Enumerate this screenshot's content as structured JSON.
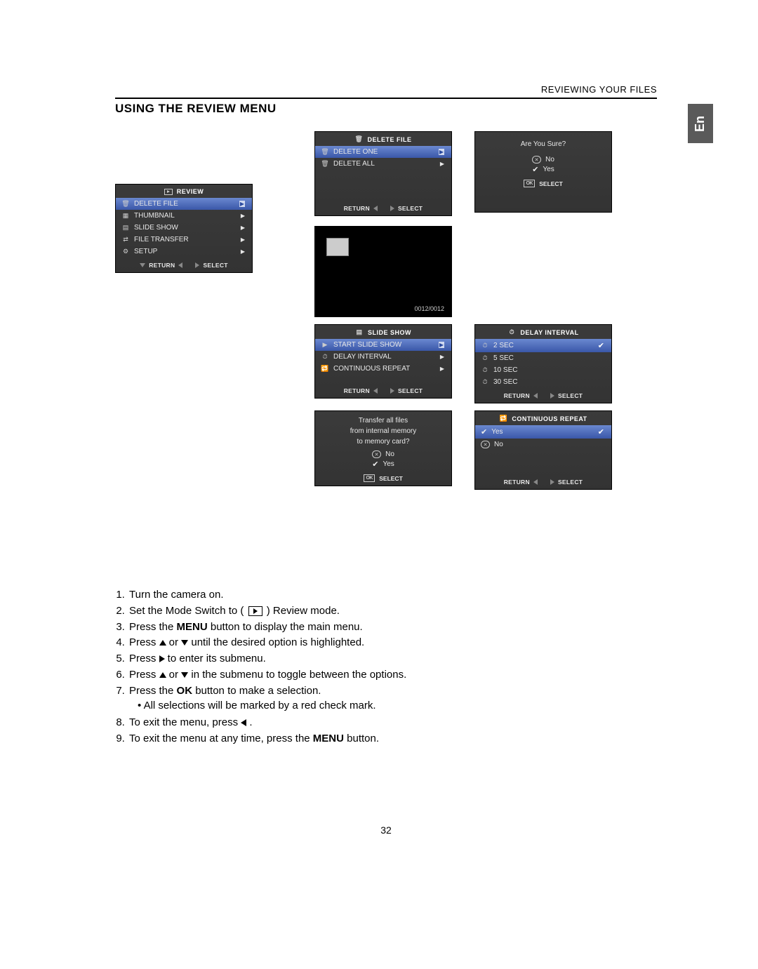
{
  "header": {
    "section": "REVIEWING YOUR FILES"
  },
  "title": "USING THE REVIEW MENU",
  "lang_tab": "En",
  "page_number": "32",
  "review_menu": {
    "title": "REVIEW",
    "items": [
      {
        "label": "DELETE FILE",
        "highlight": true
      },
      {
        "label": "THUMBNAIL"
      },
      {
        "label": "SLIDE SHOW"
      },
      {
        "label": "FILE TRANSFER"
      },
      {
        "label": "SETUP"
      }
    ],
    "footer": {
      "left": "RETURN",
      "right": "SELECT"
    }
  },
  "delete_file_menu": {
    "title": "DELETE FILE",
    "items": [
      {
        "label": "DELETE ONE",
        "highlight": true
      },
      {
        "label": "DELETE ALL"
      }
    ],
    "footer": {
      "left": "RETURN",
      "right": "SELECT"
    }
  },
  "are_you_sure": {
    "message": "Are You Sure?",
    "no": "No",
    "yes": "Yes",
    "footer": "SELECT"
  },
  "thumbnail_screen": {
    "counter": "0012/0012"
  },
  "slide_show_menu": {
    "title": "SLIDE SHOW",
    "items": [
      {
        "label": "START SLIDE SHOW",
        "highlight": true
      },
      {
        "label": "DELAY INTERVAL"
      },
      {
        "label": "CONTINUOUS REPEAT"
      }
    ],
    "footer": {
      "left": "RETURN",
      "right": "SELECT"
    }
  },
  "delay_interval_menu": {
    "title": "DELAY INTERVAL",
    "items": [
      {
        "label": "2   SEC",
        "highlight": true,
        "checked": true
      },
      {
        "label": "5   SEC"
      },
      {
        "label": "10 SEC"
      },
      {
        "label": "30 SEC"
      }
    ],
    "footer": {
      "left": "RETURN",
      "right": "SELECT"
    }
  },
  "continuous_repeat_menu": {
    "title": "CONTINUOUS REPEAT",
    "items": [
      {
        "label": "Yes",
        "highlight": true,
        "checked": true,
        "type": "check"
      },
      {
        "label": "No",
        "type": "x"
      }
    ],
    "footer": {
      "left": "RETURN",
      "right": "SELECT"
    }
  },
  "file_transfer_confirm": {
    "line1": "Transfer all files",
    "line2": "from internal memory",
    "line3": "to memory card?",
    "no": "No",
    "yes": "Yes",
    "footer": "SELECT"
  },
  "instructions": {
    "i1": "Turn the camera on.",
    "i2a": "Set the Mode Switch to (",
    "i2b": ") Review mode.",
    "i3a": "Press the ",
    "i3_menu": "MENU",
    "i3b": " button to display the main menu.",
    "i4a": "Press ",
    "i4_or": " or ",
    "i4b": " until the desired option is highlighted.",
    "i5a": "Press ",
    "i5b": " to enter its submenu.",
    "i6a": "Press ",
    "i6_or": " or ",
    "i6b": " in the submenu to toggle between the options.",
    "i7a": "Press the ",
    "i7_ok": "OK",
    "i7b": " button to make a selection.",
    "i7_sub": "All selections will be marked by a red check mark.",
    "i8": "To exit the menu, press ",
    "i8b": " .",
    "i9a": "To exit the menu at any time, press the ",
    "i9_menu": "MENU",
    "i9b": " button."
  }
}
